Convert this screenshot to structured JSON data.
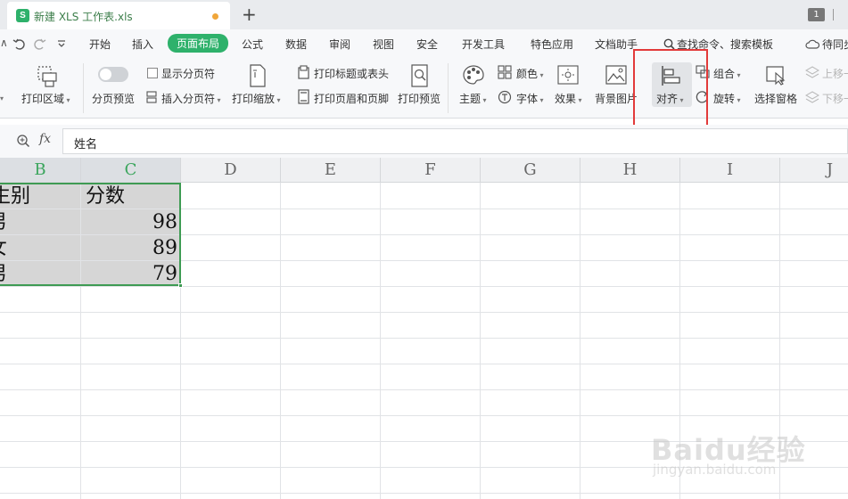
{
  "titlebar": {
    "doc_title": "新建 XLS 工作表.xls",
    "new_tab": "+",
    "window_count": "1",
    "logo_letter": "S"
  },
  "menubar": {
    "items": [
      "开始",
      "插入",
      "页面布局",
      "公式",
      "数据",
      "审阅",
      "视图",
      "安全",
      "开发工具",
      "特色应用",
      "文档助手"
    ],
    "active": "页面布局",
    "search": "查找命令、搜索模板",
    "tail": "待同步"
  },
  "ribbon": {
    "print_area": "打印区域",
    "page_break_preview": "分页预览",
    "show_page_break": "显示分页符",
    "insert_page_break": "插入分页符",
    "print_scale": "打印缩放",
    "print_titles": "打印标题或表头",
    "print_header_footer": "打印页眉和页脚",
    "print_preview": "打印预览",
    "theme": "主题",
    "colors": "颜色",
    "fonts": "字体",
    "effects": "效果",
    "background": "背景图片",
    "align": "对齐",
    "group": "组合",
    "rotate": "旋转",
    "selection_pane": "选择窗格",
    "bring_forward": "上移一层",
    "send_backward": "下移一层",
    "left_cut": "∧"
  },
  "formula": {
    "fx": "fx",
    "value": "姓名"
  },
  "grid": {
    "columns": [
      "B",
      "C",
      "D",
      "E",
      "F",
      "G",
      "H",
      "I",
      "J"
    ],
    "selected_columns": [
      "B",
      "C"
    ],
    "rows": [
      {
        "b": "生别",
        "c": "分数"
      },
      {
        "b": "男",
        "c": "98"
      },
      {
        "b": "女",
        "c": "89"
      },
      {
        "b": "男",
        "c": "79"
      }
    ]
  },
  "watermark": {
    "brand": "Baidu经验",
    "url": "jingyan.baidu.com"
  },
  "colors": {
    "accent": "#2eb16b",
    "highlight": "#e23a3a",
    "selection": "#3e9b53"
  }
}
